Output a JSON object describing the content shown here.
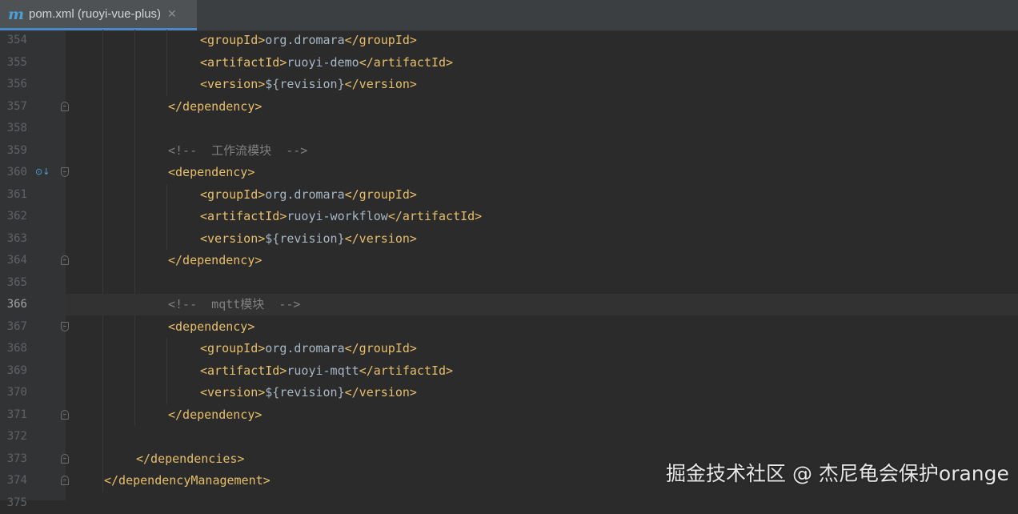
{
  "tab": {
    "icon": "maven-m-icon",
    "icon_glyph": "m",
    "title": "pom.xml (ruoyi-vue-plus)",
    "close_glyph": "✕"
  },
  "editor": {
    "current_line": 366,
    "lines": [
      {
        "num": "354",
        "indent": 4,
        "parts": [
          {
            "t": "<groupId>",
            "k": "tag"
          },
          {
            "t": "org.dromara",
            "k": "txt"
          },
          {
            "t": "</groupId>",
            "k": "tag"
          }
        ]
      },
      {
        "num": "355",
        "indent": 4,
        "parts": [
          {
            "t": "<artifactId>",
            "k": "tag"
          },
          {
            "t": "ruoyi-demo",
            "k": "txt"
          },
          {
            "t": "</artifactId>",
            "k": "tag"
          }
        ]
      },
      {
        "num": "356",
        "indent": 4,
        "parts": [
          {
            "t": "<version>",
            "k": "tag"
          },
          {
            "t": "${revision}",
            "k": "txt"
          },
          {
            "t": "</version>",
            "k": "tag"
          }
        ]
      },
      {
        "num": "357",
        "indent": 3,
        "fold": "close",
        "parts": [
          {
            "t": "</dependency>",
            "k": "tag"
          }
        ]
      },
      {
        "num": "358",
        "indent": 0,
        "parts": []
      },
      {
        "num": "359",
        "indent": 3,
        "parts": [
          {
            "t": "<!--  工作流模块  -->",
            "k": "cmt"
          }
        ]
      },
      {
        "num": "360",
        "indent": 3,
        "fold": "open",
        "impl": true,
        "parts": [
          {
            "t": "<dependency>",
            "k": "tag"
          }
        ]
      },
      {
        "num": "361",
        "indent": 4,
        "parts": [
          {
            "t": "<groupId>",
            "k": "tag"
          },
          {
            "t": "org.dromara",
            "k": "txt"
          },
          {
            "t": "</groupId>",
            "k": "tag"
          }
        ]
      },
      {
        "num": "362",
        "indent": 4,
        "parts": [
          {
            "t": "<artifactId>",
            "k": "tag"
          },
          {
            "t": "ruoyi-workflow",
            "k": "txt"
          },
          {
            "t": "</artifactId>",
            "k": "tag"
          }
        ]
      },
      {
        "num": "363",
        "indent": 4,
        "parts": [
          {
            "t": "<version>",
            "k": "tag"
          },
          {
            "t": "${revision}",
            "k": "txt"
          },
          {
            "t": "</version>",
            "k": "tag"
          }
        ]
      },
      {
        "num": "364",
        "indent": 3,
        "fold": "close",
        "parts": [
          {
            "t": "</dependency>",
            "k": "tag"
          }
        ]
      },
      {
        "num": "365",
        "indent": 0,
        "parts": []
      },
      {
        "num": "366",
        "indent": 3,
        "parts": [
          {
            "t": "<!--  mqtt模块  -->",
            "k": "cmt"
          }
        ]
      },
      {
        "num": "367",
        "indent": 3,
        "fold": "open",
        "parts": [
          {
            "t": "<dependency>",
            "k": "tag"
          }
        ]
      },
      {
        "num": "368",
        "indent": 4,
        "parts": [
          {
            "t": "<groupId>",
            "k": "tag"
          },
          {
            "t": "org.dromara",
            "k": "txt"
          },
          {
            "t": "</groupId>",
            "k": "tag"
          }
        ]
      },
      {
        "num": "369",
        "indent": 4,
        "parts": [
          {
            "t": "<artifactId>",
            "k": "tag"
          },
          {
            "t": "ruoyi-mqtt",
            "k": "txt"
          },
          {
            "t": "</artifactId>",
            "k": "tag"
          }
        ]
      },
      {
        "num": "370",
        "indent": 4,
        "parts": [
          {
            "t": "<version>",
            "k": "tag"
          },
          {
            "t": "${revision}",
            "k": "txt"
          },
          {
            "t": "</version>",
            "k": "tag"
          }
        ]
      },
      {
        "num": "371",
        "indent": 3,
        "fold": "close",
        "parts": [
          {
            "t": "</dependency>",
            "k": "tag"
          }
        ]
      },
      {
        "num": "372",
        "indent": 0,
        "parts": []
      },
      {
        "num": "373",
        "indent": 2,
        "fold": "close",
        "parts": [
          {
            "t": "</dependencies>",
            "k": "tag"
          }
        ]
      },
      {
        "num": "374",
        "indent": 1,
        "fold": "close",
        "parts": [
          {
            "t": "</dependencyManagement>",
            "k": "tag"
          }
        ]
      },
      {
        "num": "375",
        "indent": 0,
        "parts": []
      }
    ]
  },
  "watermark": "掘金技术社区 @ 杰尼龟会保护orange",
  "colors": {
    "background": "#2b2b2b",
    "gutter": "#313335",
    "tag": "#e8bf6a",
    "text": "#a9b7c6",
    "comment": "#808080",
    "line_number": "#606366"
  }
}
